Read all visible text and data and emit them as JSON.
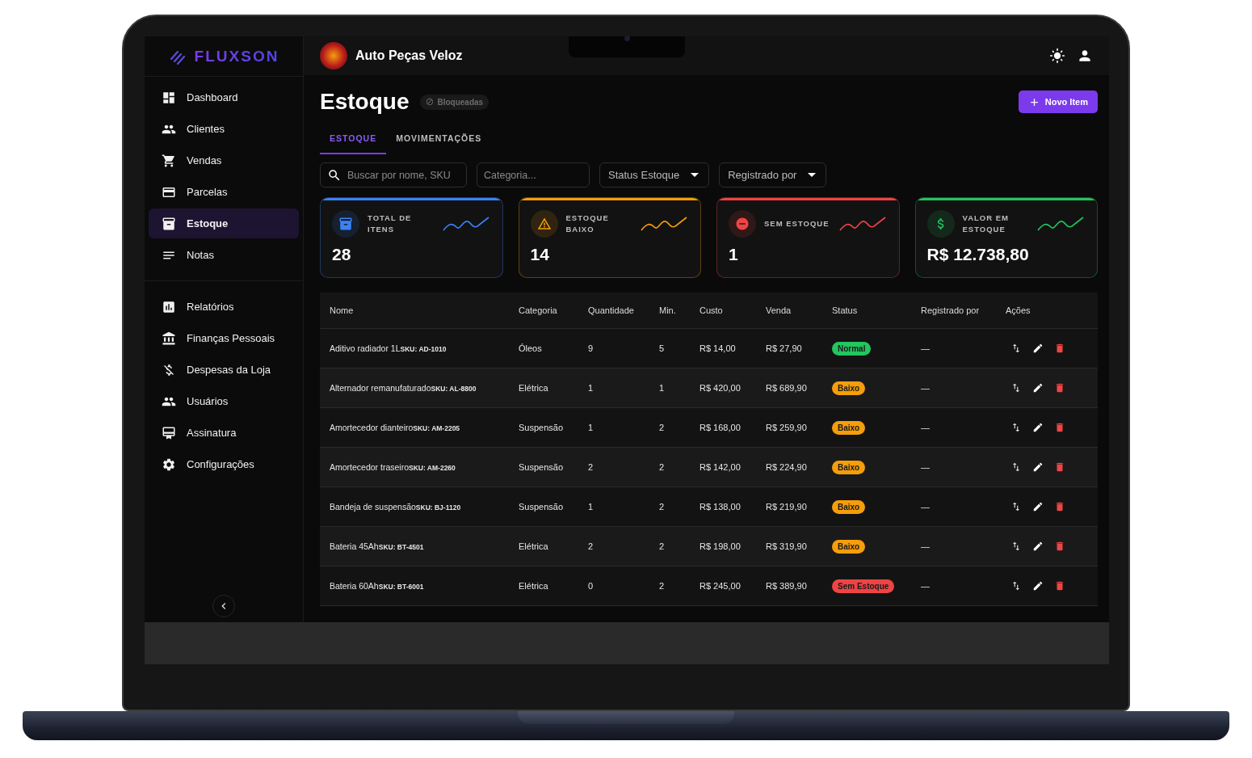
{
  "brand": {
    "name": "FLUXSON"
  },
  "header": {
    "store_name": "Auto Peças Veloz"
  },
  "sidebar": {
    "items": [
      {
        "label": "Dashboard",
        "selected": false
      },
      {
        "label": "Clientes",
        "selected": false
      },
      {
        "label": "Vendas",
        "selected": false
      },
      {
        "label": "Parcelas",
        "selected": false
      },
      {
        "label": "Estoque",
        "selected": true
      },
      {
        "label": "Notas",
        "selected": false
      }
    ],
    "items_secondary": [
      {
        "label": "Relatórios",
        "selected": false
      },
      {
        "label": "Finanças Pessoais",
        "selected": false
      },
      {
        "label": "Despesas da Loja",
        "selected": false
      },
      {
        "label": "Usuários",
        "selected": false
      },
      {
        "label": "Assinatura",
        "selected": false
      },
      {
        "label": "Configurações",
        "selected": false
      }
    ]
  },
  "page": {
    "title": "Estoque",
    "badge": "Bloqueadas",
    "new_button": "Novo Item"
  },
  "tabs": [
    {
      "label": "ESTOQUE",
      "selected": true
    },
    {
      "label": "MOVIMENTAÇÕES",
      "selected": false
    }
  ],
  "filters": {
    "search": {
      "placeholder": "Buscar por nome, SKU"
    },
    "category": {
      "placeholder": "Categoria..."
    },
    "selects": [
      {
        "label": "Status Estoque"
      },
      {
        "label": "Registrado por"
      }
    ]
  },
  "stats": [
    {
      "label": "TOTAL DE ITENS",
      "value": "28",
      "color": "#3b82f6"
    },
    {
      "label": "ESTOQUE BAIXO",
      "value": "14",
      "color": "#f59e0b"
    },
    {
      "label": "SEM ESTOQUE",
      "value": "1",
      "color": "#ef4444"
    },
    {
      "label": "VALOR EM ESTOQUE",
      "value": "R$ 12.738,80",
      "color": "#22c55e"
    }
  ],
  "table": {
    "columns": [
      "Nome",
      "Categoria",
      "Quantidade",
      "Min.",
      "Custo",
      "Venda",
      "Status",
      "Registrado por",
      "Ações"
    ],
    "rows": [
      {
        "name": "Aditivo radiador 1L",
        "sku": "SKU: AD-1010",
        "category": "Óleos",
        "quantity": "9",
        "min": "5",
        "cost": "R$ 14,00",
        "price": "R$ 27,90",
        "status": {
          "label": "Normal",
          "color": "#22c55e"
        },
        "registered_by": "—"
      },
      {
        "name": "Alternador remanufaturado",
        "sku": "SKU: AL-8800",
        "category": "Elétrica",
        "quantity": "1",
        "min": "1",
        "cost": "R$ 420,00",
        "price": "R$ 689,90",
        "status": {
          "label": "Baixo",
          "color": "#f59e0b"
        },
        "registered_by": "—"
      },
      {
        "name": "Amortecedor dianteiro",
        "sku": "SKU: AM-2205",
        "category": "Suspensão",
        "quantity": "1",
        "min": "2",
        "cost": "R$ 168,00",
        "price": "R$ 259,90",
        "status": {
          "label": "Baixo",
          "color": "#f59e0b"
        },
        "registered_by": "—"
      },
      {
        "name": "Amortecedor traseiro",
        "sku": "SKU: AM-2260",
        "category": "Suspensão",
        "quantity": "2",
        "min": "2",
        "cost": "R$ 142,00",
        "price": "R$ 224,90",
        "status": {
          "label": "Baixo",
          "color": "#f59e0b"
        },
        "registered_by": "—"
      },
      {
        "name": "Bandeja de suspensão",
        "sku": "SKU: BJ-1120",
        "category": "Suspensão",
        "quantity": "1",
        "min": "2",
        "cost": "R$ 138,00",
        "price": "R$ 219,90",
        "status": {
          "label": "Baixo",
          "color": "#f59e0b"
        },
        "registered_by": "—"
      },
      {
        "name": "Bateria 45Ah",
        "sku": "SKU: BT-4501",
        "category": "Elétrica",
        "quantity": "2",
        "min": "2",
        "cost": "R$ 198,00",
        "price": "R$ 319,90",
        "status": {
          "label": "Baixo",
          "color": "#f59e0b"
        },
        "registered_by": "—"
      },
      {
        "name": "Bateria 60Ah",
        "sku": "SKU: BT-6001",
        "category": "Elétrica",
        "quantity": "0",
        "min": "2",
        "cost": "R$ 245,00",
        "price": "R$ 389,90",
        "status": {
          "label": "Sem Estoque",
          "color": "#ef4444"
        },
        "registered_by": "—"
      }
    ]
  }
}
